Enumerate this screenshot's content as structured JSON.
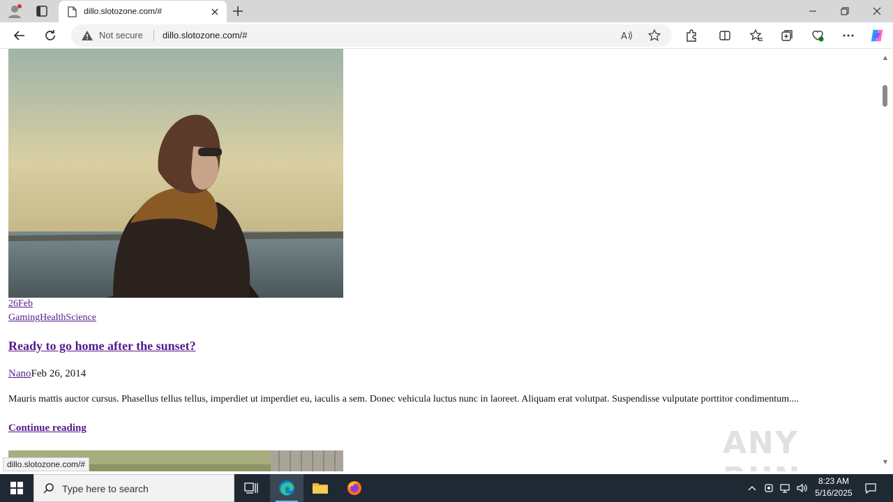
{
  "browser": {
    "tab_title": "dillo.slotozone.com/#",
    "security_label": "Not secure",
    "url": "dillo.slotozone.com/#",
    "status_url": "dillo.slotozone.com/#"
  },
  "post": {
    "date_link": "26Feb",
    "categories_link": "GamingHealthScience",
    "title": "Ready to go home after the sunset?",
    "author": "Nano",
    "date": "Feb 26, 2014",
    "excerpt": "Mauris mattis auctor cursus. Phasellus tellus tellus, imperdiet ut imperdiet eu, iaculis a sem. Donec vehicula luctus nunc in laoreet. Aliquam erat volutpat. Suspendisse vulputate porttitor condimentum....",
    "continue_label": "Continue reading"
  },
  "watermark": "ANY RUN",
  "taskbar": {
    "search_placeholder": "Type here to search",
    "time": "8:23 AM",
    "date": "5/16/2025"
  },
  "icons": {
    "accent": "#551a8b"
  }
}
